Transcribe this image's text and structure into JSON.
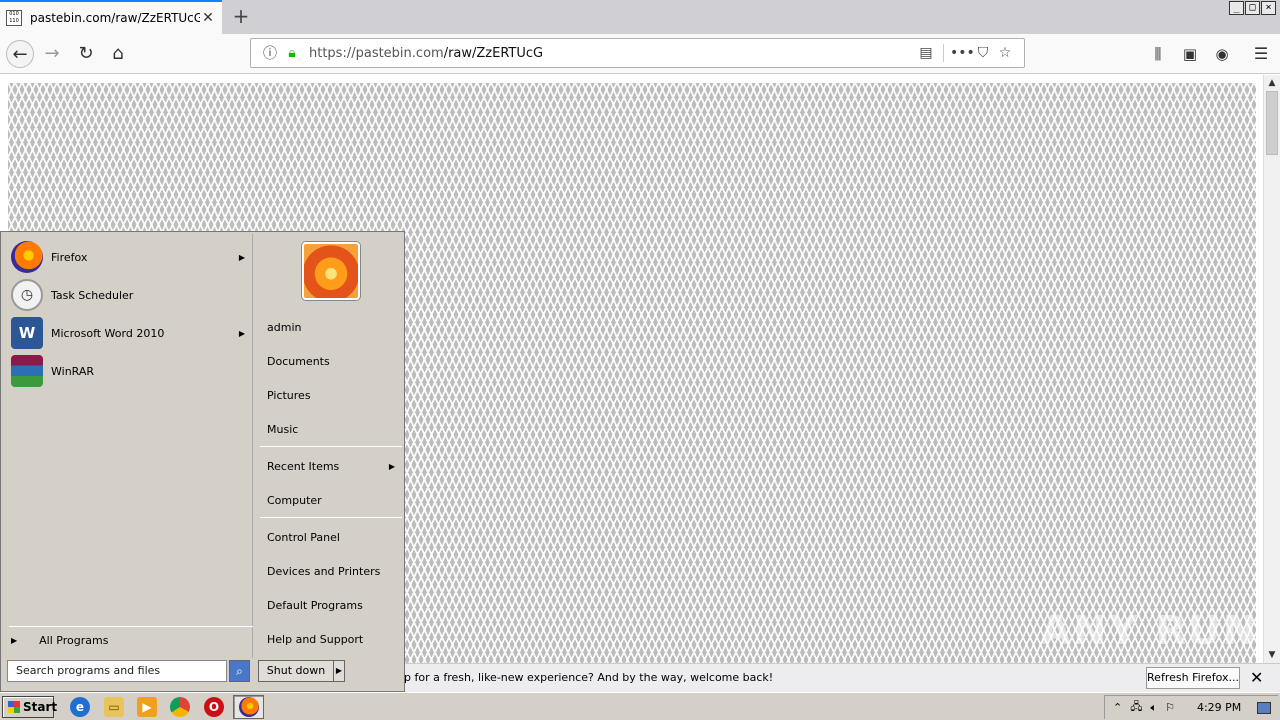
{
  "browser": {
    "tab_title": "pastebin.com/raw/ZzERTUcG",
    "tab_favicon_text": "010 110 101",
    "new_tab_glyph": "+",
    "url_host": "https://pastebin.com",
    "url_path": "/raw/ZzERTUcG",
    "window_controls": [
      "_",
      "□",
      "×"
    ]
  },
  "page": {
    "watermark": "ANY RUN"
  },
  "notification": {
    "message": "p for a fresh, like-new experience? And by the way, welcome back!",
    "refresh_button": "Refresh Firefox..."
  },
  "start_menu": {
    "programs": [
      {
        "label": "Firefox",
        "has_submenu": true,
        "icon": "firefox-icon",
        "color": "#e66000"
      },
      {
        "label": "Task Scheduler",
        "has_submenu": false,
        "icon": "clock-icon",
        "color": "#c9c9c9"
      },
      {
        "label": "Microsoft Word 2010",
        "has_submenu": true,
        "icon": "word-icon",
        "color": "#2b5797"
      },
      {
        "label": "WinRAR",
        "has_submenu": false,
        "icon": "winrar-icon",
        "color": "#8b1a4a"
      }
    ],
    "all_programs": "All Programs",
    "search_placeholder": "Search programs and files",
    "places": [
      {
        "label": "admin"
      },
      {
        "label": "Documents"
      },
      {
        "label": "Pictures"
      },
      {
        "label": "Music"
      },
      {
        "label": "Recent Items",
        "has_submenu": true
      },
      {
        "label": "Computer"
      },
      {
        "label": "Control Panel"
      },
      {
        "label": "Devices and Printers"
      },
      {
        "label": "Default Programs"
      },
      {
        "label": "Help and Support"
      }
    ],
    "shutdown": "Shut down"
  },
  "taskbar": {
    "start": "Start",
    "clock": "4:29 PM"
  },
  "colors": {
    "accent": "#0a84ff",
    "secure_lock": "#12bc00"
  }
}
